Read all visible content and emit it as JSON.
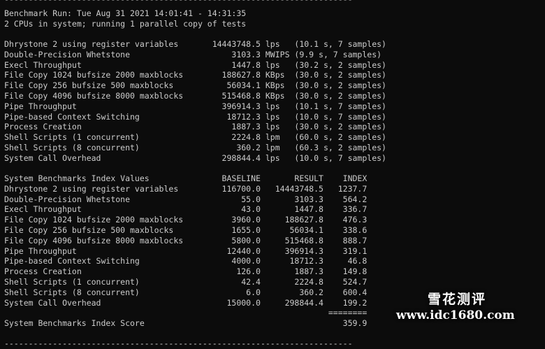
{
  "terminal": {
    "separator_top": "------------------------------------------------------------------------",
    "header_lines": [
      "Benchmark Run: Tue Aug 31 2021 14:01:41 - 14:31:35",
      "2 CPUs in system; running 1 parallel copy of tests"
    ],
    "test_results": [
      "Dhrystone 2 using register variables       14443748.5 lps   (10.1 s, 7 samples)",
      "Double-Precision Whetstone                     3103.3 MWIPS (9.9 s, 7 samples)",
      "Execl Throughput                               1447.8 lps   (30.2 s, 2 samples)",
      "File Copy 1024 bufsize 2000 maxblocks        188627.8 KBps  (30.0 s, 2 samples)",
      "File Copy 256 bufsize 500 maxblocks           56034.1 KBps  (30.0 s, 2 samples)",
      "File Copy 4096 bufsize 8000 maxblocks        515468.8 KBps  (30.0 s, 2 samples)",
      "Pipe Throughput                              396914.3 lps   (10.1 s, 7 samples)",
      "Pipe-based Context Switching                  18712.3 lps   (10.0 s, 7 samples)",
      "Process Creation                               1887.3 lps   (30.0 s, 2 samples)",
      "Shell Scripts (1 concurrent)                   2224.8 lpm   (60.0 s, 2 samples)",
      "Shell Scripts (8 concurrent)                    360.2 lpm   (60.3 s, 2 samples)",
      "System Call Overhead                         298844.4 lps   (10.0 s, 7 samples)"
    ],
    "index_header": "System Benchmarks Index Values               BASELINE       RESULT    INDEX",
    "index_rows": [
      "Dhrystone 2 using register variables         116700.0   14443748.5   1237.7",
      "Double-Precision Whetstone                       55.0       3103.3    564.2",
      "Execl Throughput                                 43.0       1447.8    336.7",
      "File Copy 1024 bufsize 2000 maxblocks          3960.0     188627.8    476.3",
      "File Copy 256 bufsize 500 maxblocks            1655.0      56034.1    338.6",
      "File Copy 4096 bufsize 8000 maxblocks          5800.0     515468.8    888.7",
      "Pipe Throughput                               12440.0     396914.3    319.1",
      "Pipe-based Context Switching                   4000.0      18712.3     46.8",
      "Process Creation                                126.0       1887.3    149.8",
      "Shell Scripts (1 concurrent)                     42.4       2224.8    524.7",
      "Shell Scripts (8 concurrent)                      6.0        360.2    600.4",
      "System Call Overhead                          15000.0     298844.4    199.2"
    ],
    "index_rule": "                                                                   ========",
    "score_line": "System Benchmarks Index Score                                         359.9",
    "separator_bottom": "------------------------------------------------------------------------"
  },
  "watermark": {
    "name": "雪花测评",
    "url": "www.idc1680.com"
  }
}
